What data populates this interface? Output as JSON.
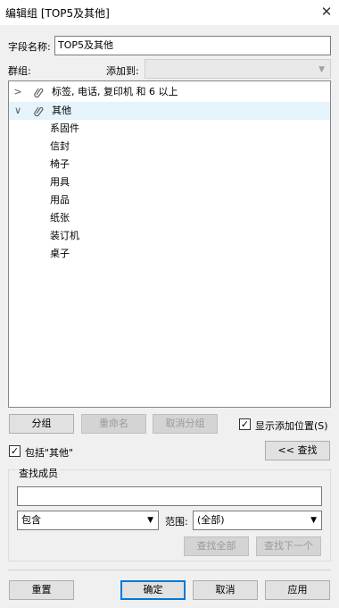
{
  "window": {
    "title": "编辑组 [TOP5及其他]",
    "close": "✕"
  },
  "field_name": {
    "label": "字段名称:",
    "value": "TOP5及其他"
  },
  "group": {
    "label": "群组:",
    "add_to_label": "添加到:"
  },
  "tree": {
    "groups": [
      {
        "label": "标签, 电话, 复印机 和 6 以上",
        "expanded": false,
        "selected": false
      },
      {
        "label": "其他",
        "expanded": true,
        "selected": true
      }
    ],
    "members": [
      "系固件",
      "信封",
      "椅子",
      "用具",
      "用品",
      "纸张",
      "装订机",
      "桌子"
    ]
  },
  "buttons": {
    "group": "分组",
    "rename": "重命名",
    "ungroup": "取消分组",
    "find_toggle": "<< 查找",
    "find_all": "查找全部",
    "find_next": "查找下一个",
    "reset": "重置",
    "ok": "确定",
    "cancel": "取消",
    "apply": "应用"
  },
  "options": {
    "show_add_position": {
      "label": "显示添加位置(S)",
      "checked": true
    },
    "include_other": {
      "label": "包括\"其他\"",
      "checked": true
    }
  },
  "find": {
    "title": "查找成员",
    "query": "",
    "match_mode": "包含",
    "scope_label": "范围:",
    "scope_value": "(全部)"
  },
  "icons": {
    "collapsed": "chevron-right-icon",
    "expanded": "chevron-down-icon",
    "group": "paperclip-icon",
    "dropdown": "dropdown-arrow-icon",
    "check": "checkmark-icon"
  }
}
